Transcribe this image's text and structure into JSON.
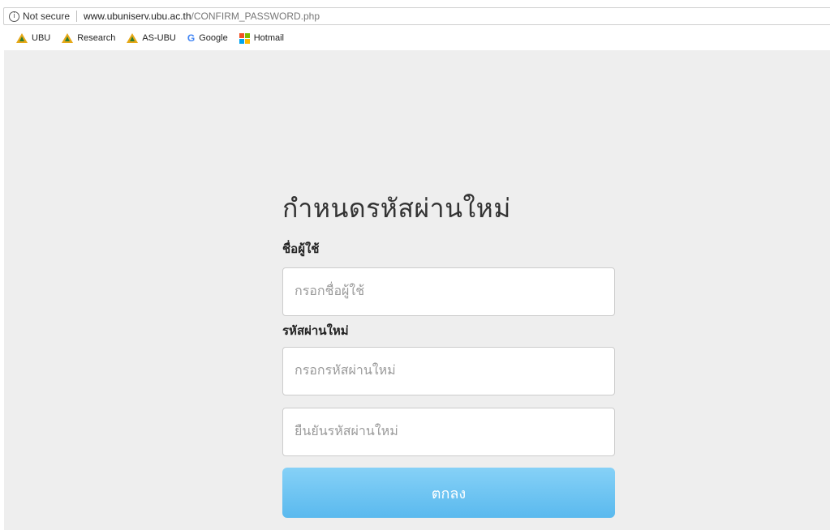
{
  "browser": {
    "security_label": "Not secure",
    "url_host": "www.ubuniserv.ubu.ac.th",
    "url_path": "/CONFIRM_PASSWORD.php",
    "bookmarks": [
      {
        "label": "UBU",
        "icon": "ubu-logo-icon"
      },
      {
        "label": "Research",
        "icon": "ubu-logo-icon"
      },
      {
        "label": "AS-UBU",
        "icon": "ubu-logo-icon"
      },
      {
        "label": "Google",
        "icon": "google-icon"
      },
      {
        "label": "Hotmail",
        "icon": "microsoft-icon"
      }
    ]
  },
  "form": {
    "title": "กำหนดรหัสผ่านใหม่",
    "username_label": "ชื่อผู้ใช้",
    "username_placeholder": "กรอกชื่อผู้ใช้",
    "password_label": "รหัสผ่านใหม่",
    "password_placeholder": "กรอกรหัสผ่านใหม่",
    "confirm_placeholder": "ยืนยันรหัสผ่านใหม่",
    "submit_label": "ตกลง"
  },
  "colors": {
    "page_background": "#eeeeee",
    "button": "#6cc4f3",
    "button_text": "#ffffff"
  }
}
